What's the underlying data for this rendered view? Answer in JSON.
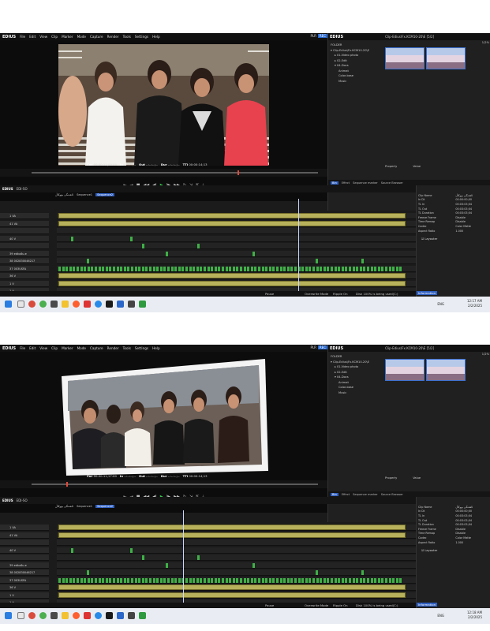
{
  "screens": [
    {
      "menu": {
        "logo": "EDIUS",
        "items": [
          "File",
          "Edit",
          "View",
          "Clip",
          "Marker",
          "Mode",
          "Capture",
          "Render",
          "Tools",
          "Settings",
          "Help"
        ],
        "plr": "PLR",
        "rec": "REC"
      },
      "player": {
        "timecode_cur_label": "Cur",
        "timecode_cur": "00:00:11;09:04",
        "in_label": "In",
        "in": "--:--:--;--",
        "out_label": "Out",
        "out": "--:--:--;--",
        "dur_label": "Dur",
        "dur": "--:--:--;--",
        "ttl_label": "TTl",
        "ttl": "00:00:14;13",
        "scrub_progress": 0.72
      },
      "bin": {
        "logo": "EDIUS",
        "path": "Clip-Edius\\Fx.KCM10-20\\E [5/2]",
        "folder_label": "FOLDER",
        "folders": [
          "Clip-Edius\\Fx.KCM10-20\\E",
          "01-Video photo",
          "02-Edit",
          "04-Docs",
          "Animat",
          "Color-base",
          "Music"
        ],
        "clip_count": "1/2%",
        "properties_label": "Property",
        "value_label": "Value",
        "tabs": [
          "Bin",
          "Effect",
          "Sequence marker",
          "Source Browser"
        ]
      },
      "timeline": {
        "logo": "EDIUS",
        "project": "EDI-SO",
        "seq_tabs": [
          "ئاهەنگی بووکاڵ",
          "Sequence1",
          "Sequence2"
        ],
        "tracks": [
          "1 VA",
          "41 VA",
          "",
          "40 V",
          "",
          "39 edku6u.e",
          "38 002830046217",
          "37 003USFA",
          "36 V",
          "1 V",
          "1 A"
        ],
        "playhead_ratio": 0.69
      },
      "info": {
        "rows": [
          [
            "Clip Name",
            "ئاهەنگی بووکاڵ"
          ],
          [
            "In Dt",
            "00:00:00;00"
          ],
          [
            "TL In",
            "00:03:03;04"
          ],
          [
            "TL Out",
            "00:03:03;04"
          ],
          [
            "TL Duration",
            "00:03:03;04"
          ],
          [
            "Freeze Frame",
            "Disable"
          ],
          [
            "Time Remap",
            "Disable"
          ],
          [
            "Codec",
            "Color Matte"
          ],
          [
            "Aspect Ratio",
            "1.000"
          ]
        ],
        "layer": "Layouter",
        "tab": "Information"
      },
      "status": {
        "pause": "Pause",
        "overwrite": "Overwrite Mode",
        "ripple": "Ripple On",
        "disk": "Disk 100% is being used(C:)"
      },
      "taskbar": {
        "lang": "ENG",
        "time": "12:17 AM",
        "date": "2/2/2025"
      }
    },
    {
      "menu": {
        "logo": "EDIUS",
        "items": [
          "File",
          "Edit",
          "View",
          "Clip",
          "Marker",
          "Mode",
          "Capture",
          "Render",
          "Tools",
          "Settings",
          "Help"
        ],
        "plr": "PLR",
        "rec": "REC"
      },
      "player": {
        "timecode_cur_label": "Cur",
        "timecode_cur": "00:00:11;17:00",
        "in_label": "In",
        "in": "--:--:--;--",
        "out_label": "Out",
        "out": "--:--:--;--",
        "dur_label": "Dur",
        "dur": "--:--:--;--",
        "ttl_label": "TTl",
        "ttl": "00:00:14;13",
        "scrub_progress": 0.12
      },
      "bin": {
        "logo": "EDIUS",
        "path": "Clip-Edius\\Fx.KCM10-20\\E [5/2]",
        "folder_label": "FOLDER",
        "folders": [
          "Clip-Edius\\Fx.KCM10-20\\E",
          "01-Video photo",
          "02-Edit",
          "04-Docs",
          "Animat",
          "Color-base",
          "Music"
        ],
        "clip_count": "1/2%",
        "properties_label": "Property",
        "value_label": "Value",
        "tabs": [
          "Bin",
          "Effect",
          "Sequence marker",
          "Source Browser"
        ]
      },
      "timeline": {
        "logo": "EDIUS",
        "project": "EDI-SO",
        "seq_tabs": [
          "ئاهەنگی بووکاڵ",
          "Sequence1",
          "Sequence2"
        ],
        "tracks": [
          "1 VA",
          "41 VA",
          "",
          "40 V",
          "",
          "39 edku6u.e",
          "38 002830046217",
          "37 003USFA",
          "36 V",
          "1 V",
          "1 A"
        ],
        "playhead_ratio": 0.36
      },
      "info": {
        "rows": [
          [
            "Clip Name",
            "ئاهەنگی بووکاڵ"
          ],
          [
            "In Dt",
            "00:00:00;00"
          ],
          [
            "TL In",
            "00:03:03;04"
          ],
          [
            "TL Out",
            "00:03:03;04"
          ],
          [
            "TL Duration",
            "00:03:03;04"
          ],
          [
            "Freeze Frame",
            "Disable"
          ],
          [
            "Time Remap",
            "Disable"
          ],
          [
            "Codec",
            "Color Matte"
          ],
          [
            "Aspect Ratio",
            "1.000"
          ]
        ],
        "layer": "Layouter",
        "tab": "Information"
      },
      "status": {
        "pause": "Pause",
        "overwrite": "Overwrite Mode",
        "ripple": "Ripple On",
        "disk": "Disk 100% is being used(C:)"
      },
      "taskbar": {
        "lang": "ENG",
        "time": "12:18 AM",
        "date": "2/2/2025"
      }
    }
  ],
  "colors": {
    "accent": "#2f5fc0",
    "clip_yellow": "#b8b15c",
    "clip_green": "#3fb047",
    "bg": "#1b1b1b"
  }
}
